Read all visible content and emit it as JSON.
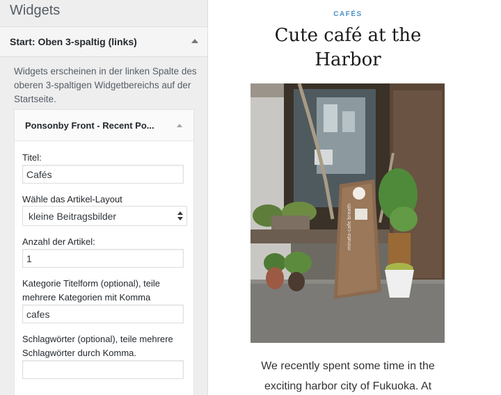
{
  "panel": {
    "title": "Widgets",
    "section_title": "Start: Oben 3-spaltig (links)",
    "description": "Widgets erscheinen in der linken Spalte des oberen 3-spaltigen Widgetbereichs auf der Startseite."
  },
  "widget": {
    "title": "Ponsonby Front - Recent Po...",
    "fields": {
      "title_label": "Titel:",
      "title_value": "Cafés",
      "layout_label": "Wähle das Artikel-Layout",
      "layout_value": "kleine Beitragsbilder",
      "count_label": "Anzahl der Artikel:",
      "count_value": "1",
      "category_label": "Kategorie Titelform (optional), teile mehrere Kategorien mit Komma",
      "category_value": "cafes",
      "tags_label": "Schlagwörter (optional), teile mehrere Schlagwörter durch Komma.",
      "tags_value": ""
    }
  },
  "preview": {
    "category": "CAFÉS",
    "post_title": "Cute café at the Harbor",
    "excerpt": "We recently spent some time in the exciting harbor city of Fukuoka. At",
    "image_sign_text": "minato-cafe breath",
    "accent_color": "#4a90c8"
  }
}
